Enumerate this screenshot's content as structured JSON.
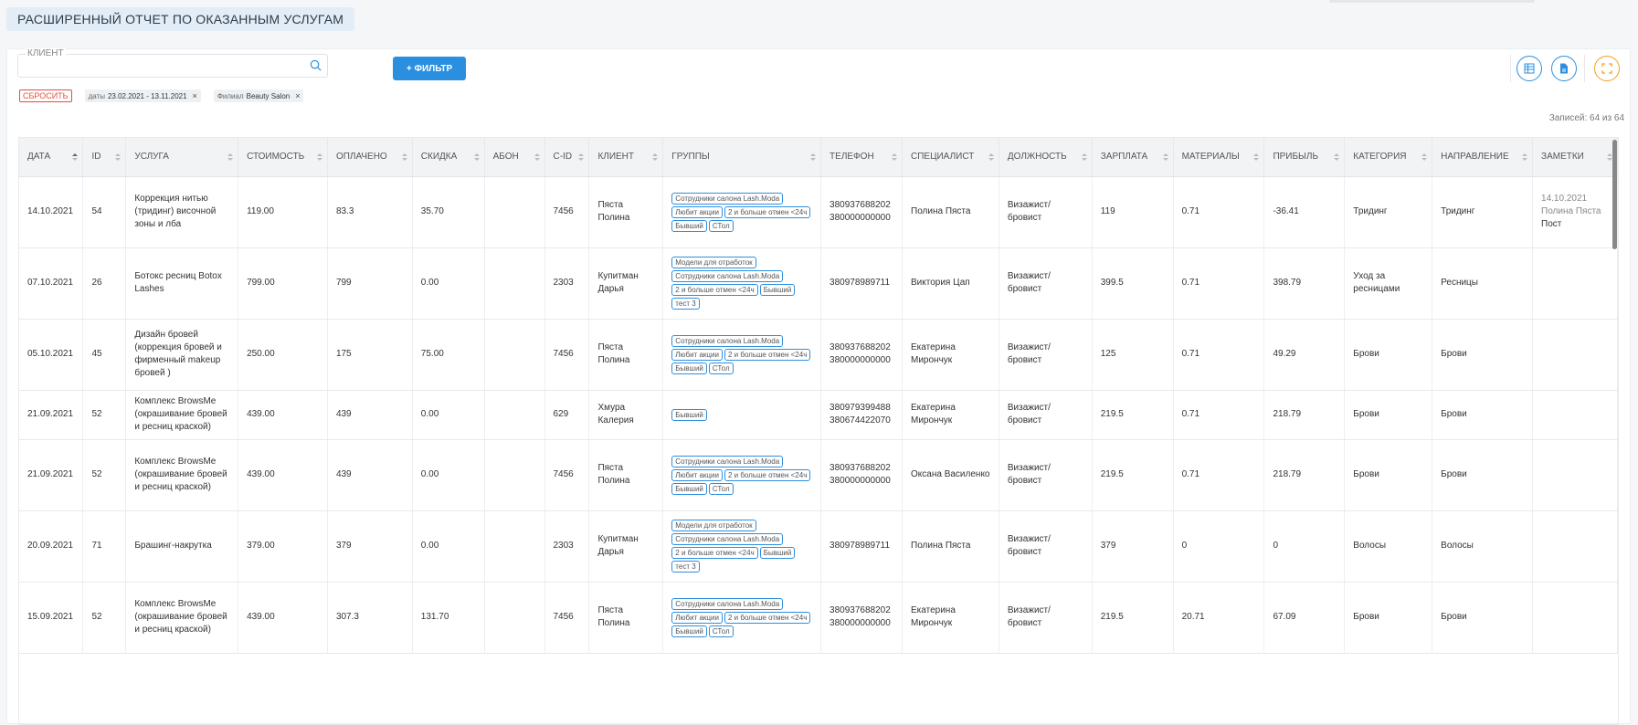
{
  "page": {
    "title": "РАСШИРЕННЫЙ ОТЧЕТ ПО ОКАЗАННЫМ УСЛУГАМ"
  },
  "filters": {
    "client_label": "КЛИЕНТ",
    "client_value": "",
    "add_filter_label": "+ ФИЛЬТР",
    "reset_label": "СБРОСИТЬ",
    "date_chip_label": "даты",
    "date_chip_value": "23.02.2021 - 13.11.2021",
    "branch_chip_label": "Филиал",
    "branch_chip_value": "Beauty Salon",
    "chip_close": "×"
  },
  "toolbar": {
    "columns_icon": "columns-icon",
    "export_icon": "document-icon",
    "fullscreen_icon": "fullscreen-icon"
  },
  "records": "Записей: 64 из 64",
  "colors": {
    "accent": "#2b8fe0",
    "reset": "#e74c3c",
    "fullscreen": "#f0a020"
  },
  "table": {
    "columns": [
      "ДАТА",
      "ID",
      "УСЛУГА",
      "СТОИМОСТЬ",
      "ОПЛАЧЕНО",
      "СКИДКА",
      "АБОН",
      "С-ID",
      "КЛИЕНТ",
      "ГРУППЫ",
      "ТЕЛЕФОН",
      "СПЕЦИАЛИСТ",
      "ДОЛЖНОСТЬ",
      "ЗАРПЛАТА",
      "МАТЕРИАЛЫ",
      "ПРИБЫЛЬ",
      "КАТЕГОРИЯ",
      "НАПРАВЛЕНИЕ",
      "ЗАМЕТКИ"
    ],
    "rows": [
      {
        "date": "14.10.2021",
        "id": "54",
        "service": "Коррекция нитью (тридинг) височной зоны и лба",
        "cost": "119.00",
        "paid": "83.3",
        "discount": "35.70",
        "abon": "",
        "cid": "7456",
        "client": "Пяста Полина",
        "groups": [
          "Сотрудники салона Lash.Moda",
          "Любит акции",
          "2 и больше отмен <24ч",
          "Бывший",
          "СТол"
        ],
        "phone": "380937688202\n380000000000",
        "specialist": "Полина Пяста",
        "position": "Визажист/ бровист",
        "salary": "119",
        "materials": "0.71",
        "profit": "-36.41",
        "category": "Тридинг",
        "direction": "Тридинг",
        "note_date": "14.10.2021",
        "note_author": "Полина Пяста",
        "note_text": "Пост"
      },
      {
        "date": "07.10.2021",
        "id": "26",
        "service": "Ботокс ресниц Botox Lashes",
        "cost": "799.00",
        "paid": "799",
        "discount": "0.00",
        "abon": "",
        "cid": "2303",
        "client": "Купитман Дарья",
        "groups": [
          "Модели для отработок",
          "Сотрудники салона Lash.Moda",
          "2 и больше отмен <24ч",
          "Бывший",
          "тест 3"
        ],
        "phone": "380978989711",
        "specialist": "Виктория Цап",
        "position": "Визажист/ бровист",
        "salary": "399.5",
        "materials": "0.71",
        "profit": "398.79",
        "category": "Уход за ресницами",
        "direction": "Ресницы",
        "note_date": "",
        "note_author": "",
        "note_text": ""
      },
      {
        "date": "05.10.2021",
        "id": "45",
        "service": "Дизайн бровей (коррекция бровей и фирменный makeup бровей )",
        "cost": "250.00",
        "paid": "175",
        "discount": "75.00",
        "abon": "",
        "cid": "7456",
        "client": "Пяста Полина",
        "groups": [
          "Сотрудники салона Lash.Moda",
          "Любит акции",
          "2 и больше отмен <24ч",
          "Бывший",
          "СТол"
        ],
        "phone": "380937688202\n380000000000",
        "specialist": "Екатерина Мирончук",
        "position": "Визажист/ бровист",
        "salary": "125",
        "materials": "0.71",
        "profit": "49.29",
        "category": "Брови",
        "direction": "Брови",
        "note_date": "",
        "note_author": "",
        "note_text": ""
      },
      {
        "date": "21.09.2021",
        "id": "52",
        "service": "Комплекс BrowsMe (окрашивание бровей и ресниц краской)",
        "cost": "439.00",
        "paid": "439",
        "discount": "0.00",
        "abon": "",
        "cid": "629",
        "client": "Хмура Калерия",
        "groups": [
          "Бывший"
        ],
        "phone": "380979399488\n380674422070",
        "specialist": "Екатерина Мирончук",
        "position": "Визажист/ бровист",
        "salary": "219.5",
        "materials": "0.71",
        "profit": "218.79",
        "category": "Брови",
        "direction": "Брови",
        "note_date": "",
        "note_author": "",
        "note_text": ""
      },
      {
        "date": "21.09.2021",
        "id": "52",
        "service": "Комплекс BrowsMe (окрашивание бровей и ресниц краской)",
        "cost": "439.00",
        "paid": "439",
        "discount": "0.00",
        "abon": "",
        "cid": "7456",
        "client": "Пяста Полина",
        "groups": [
          "Сотрудники салона Lash.Moda",
          "Любит акции",
          "2 и больше отмен <24ч",
          "Бывший",
          "СТол"
        ],
        "phone": "380937688202\n380000000000",
        "specialist": "Оксана Василенко",
        "position": "Визажист/ бровист",
        "salary": "219.5",
        "materials": "0.71",
        "profit": "218.79",
        "category": "Брови",
        "direction": "Брови",
        "note_date": "",
        "note_author": "",
        "note_text": ""
      },
      {
        "date": "20.09.2021",
        "id": "71",
        "service": "Брашинг-накрутка",
        "cost": "379.00",
        "paid": "379",
        "discount": "0.00",
        "abon": "",
        "cid": "2303",
        "client": "Купитман Дарья",
        "groups": [
          "Модели для отработок",
          "Сотрудники салона Lash.Moda",
          "2 и больше отмен <24ч",
          "Бывший",
          "тест 3"
        ],
        "phone": "380978989711",
        "specialist": "Полина Пяста",
        "position": "Визажист/ бровист",
        "salary": "379",
        "materials": "0",
        "profit": "0",
        "category": "Волосы",
        "direction": "Волосы",
        "note_date": "",
        "note_author": "",
        "note_text": ""
      },
      {
        "date": "15.09.2021",
        "id": "52",
        "service": "Комплекс BrowsMe (окрашивание бровей и ресниц краской)",
        "cost": "439.00",
        "paid": "307.3",
        "discount": "131.70",
        "abon": "",
        "cid": "7456",
        "client": "Пяста Полина",
        "groups": [
          "Сотрудники салона Lash.Moda",
          "Любит акции",
          "2 и больше отмен <24ч",
          "Бывший",
          "СТол"
        ],
        "phone": "380937688202\n380000000000",
        "specialist": "Екатерина Мирончук",
        "position": "Визажист/ бровист",
        "salary": "219.5",
        "materials": "20.71",
        "profit": "67.09",
        "category": "Брови",
        "direction": "Брови",
        "note_date": "",
        "note_author": "",
        "note_text": ""
      }
    ]
  }
}
